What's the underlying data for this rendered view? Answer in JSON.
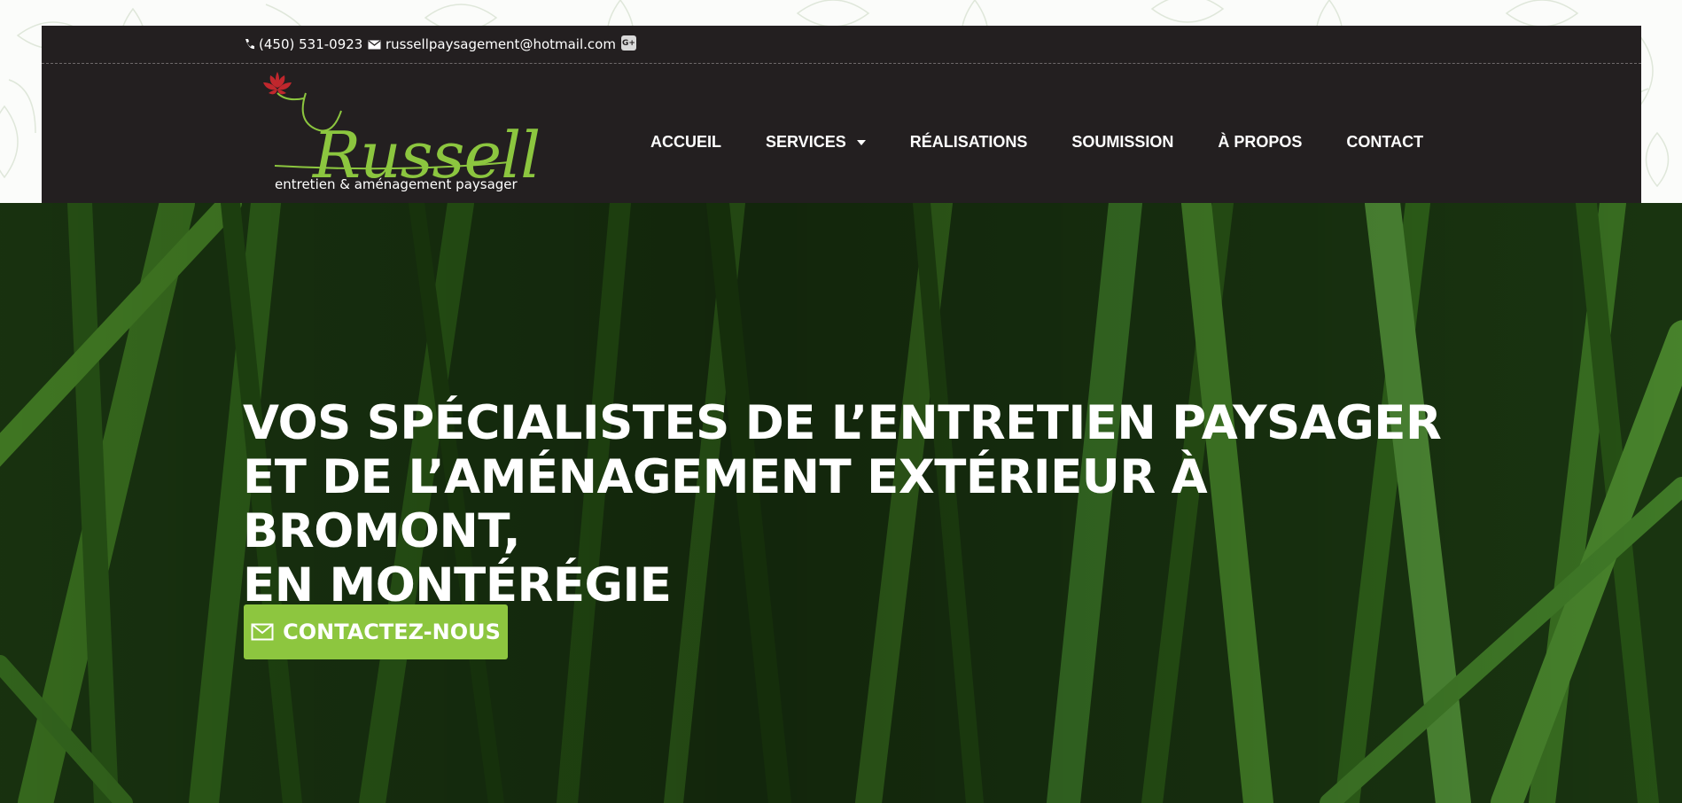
{
  "topbar": {
    "phone": "(450) 531-0923",
    "email": "russellpaysagement@hotmail.com",
    "social_icon": "google-plus-icon"
  },
  "logo": {
    "wordmark": "Russell",
    "tagline": "entretien & aménagement paysager"
  },
  "nav": {
    "items": [
      {
        "label": "ACCUEIL"
      },
      {
        "label": "SERVICES",
        "has_dropdown": true
      },
      {
        "label": "RÉALISATIONS"
      },
      {
        "label": "SOUMISSION"
      },
      {
        "label": "À PROPOS"
      },
      {
        "label": "CONTACT"
      }
    ]
  },
  "hero": {
    "title_lines": [
      "VOS SPÉCIALISTES DE L’ENTRETIEN PAYSAGER",
      "ET DE L’AMÉNAGEMENT EXTÉRIEUR À BROMONT,",
      "EN MONTÉRÉGIE"
    ],
    "cta_label": "CONTACTEZ-NOUS",
    "cta_icon": "envelope-icon"
  },
  "colors": {
    "header_bg": "#231f20",
    "accent_green": "#8dc63f",
    "flower_red": "#c0272d",
    "hero_dark": "#1a3512"
  }
}
